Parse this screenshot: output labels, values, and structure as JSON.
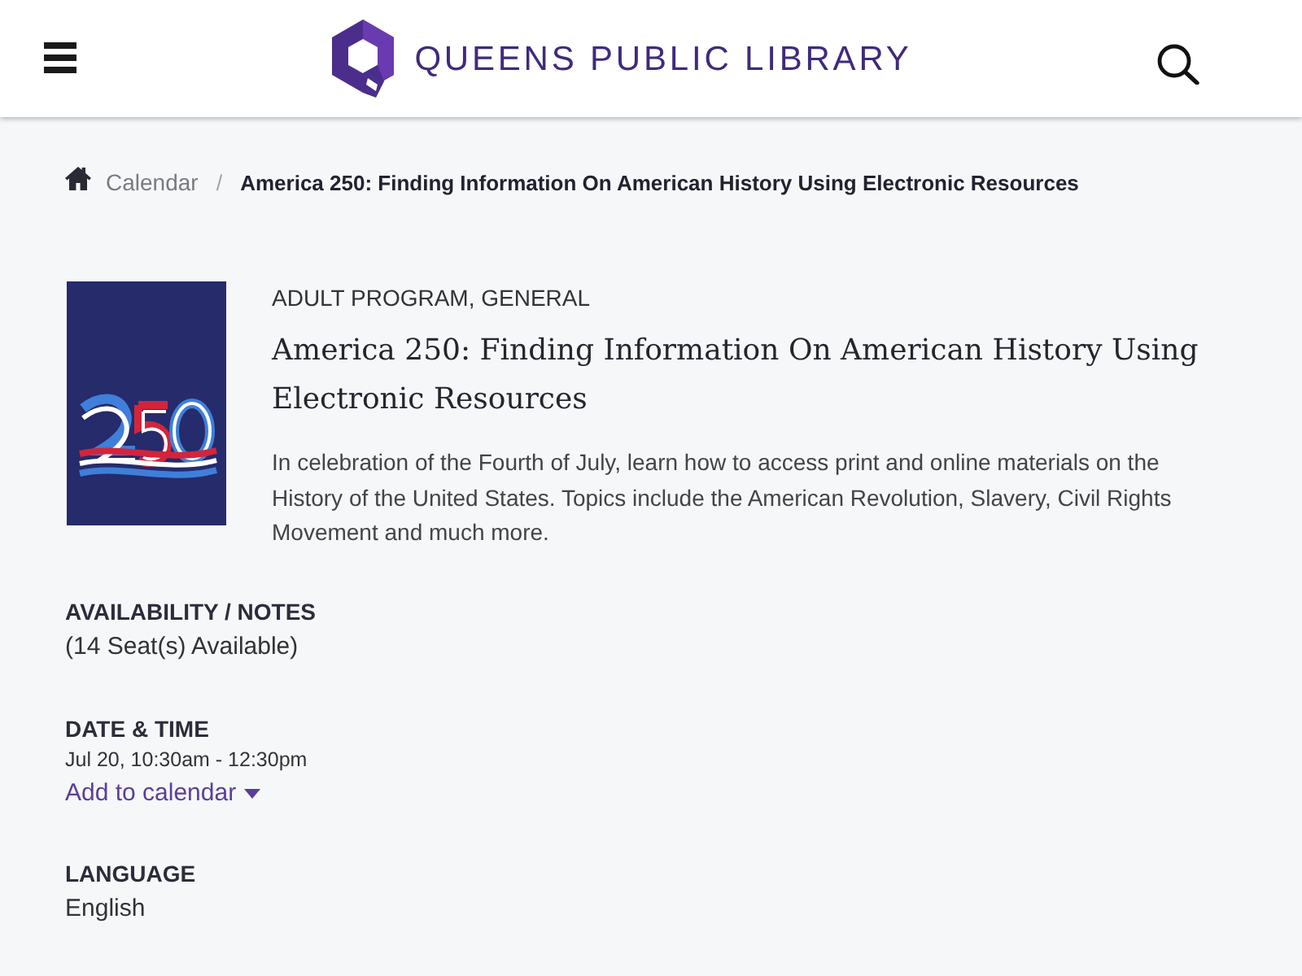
{
  "header": {
    "logo_text": "QUEENS PUBLIC LIBRARY"
  },
  "breadcrumb": {
    "separator": "/",
    "items": [
      {
        "kind": "link",
        "label": "Calendar"
      },
      {
        "kind": "current",
        "label": "America 250: Finding Information On American History Using Electronic Resources"
      }
    ]
  },
  "event": {
    "categories": "ADULT PROGRAM, GENERAL",
    "title": "America 250: Finding Information On American History Using Electronic Resources",
    "description": "In celebration of the Fourth of July, learn how to access print and online materials on the History of the United States. Topics include the American Revolution, Slavery, Civil Rights Movement and much more."
  },
  "details": [
    {
      "heading": "AVAILABILITY / NOTES",
      "lines": [
        {
          "kind": "value",
          "text": "(14 Seat(s) Available)"
        }
      ]
    },
    {
      "heading": "DATE & TIME",
      "lines": [
        {
          "kind": "small",
          "text": "Jul 20, 10:30am - 12:30pm"
        },
        {
          "kind": "dropdown-link",
          "text": "Add to calendar"
        }
      ]
    },
    {
      "heading": "LANGUAGE",
      "lines": [
        {
          "kind": "value",
          "text": "English"
        }
      ]
    }
  ]
}
